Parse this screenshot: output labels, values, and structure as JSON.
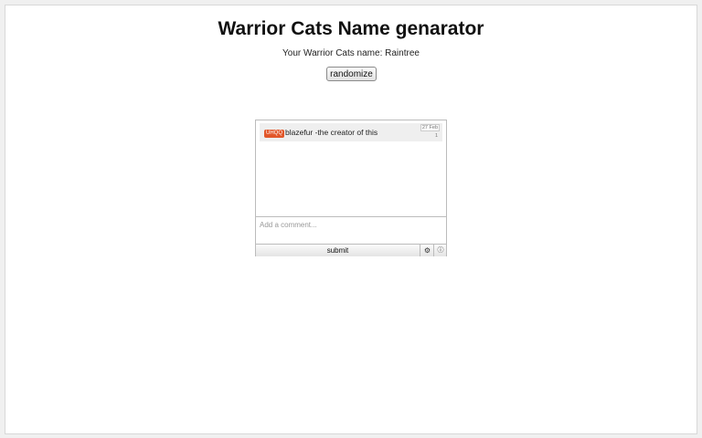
{
  "header": {
    "title": "Warrior Cats Name genarator"
  },
  "result": {
    "prefix": "Your Warrior Cats name",
    "name": "Raintree"
  },
  "controls": {
    "randomize_label": "randomize"
  },
  "comments_widget": {
    "items": [
      {
        "badge": "UHQQ",
        "text": "blazefur -the creator of this",
        "date": "27 Feb",
        "count": "1"
      }
    ],
    "input_placeholder": "Add a comment...",
    "submit_label": "submit",
    "settings_icon": "gear-icon",
    "info_icon": "info-icon"
  },
  "colors": {
    "badge": "#e2572a",
    "page_bg": "#ffffff",
    "outer_bg": "#f0f0f0"
  }
}
